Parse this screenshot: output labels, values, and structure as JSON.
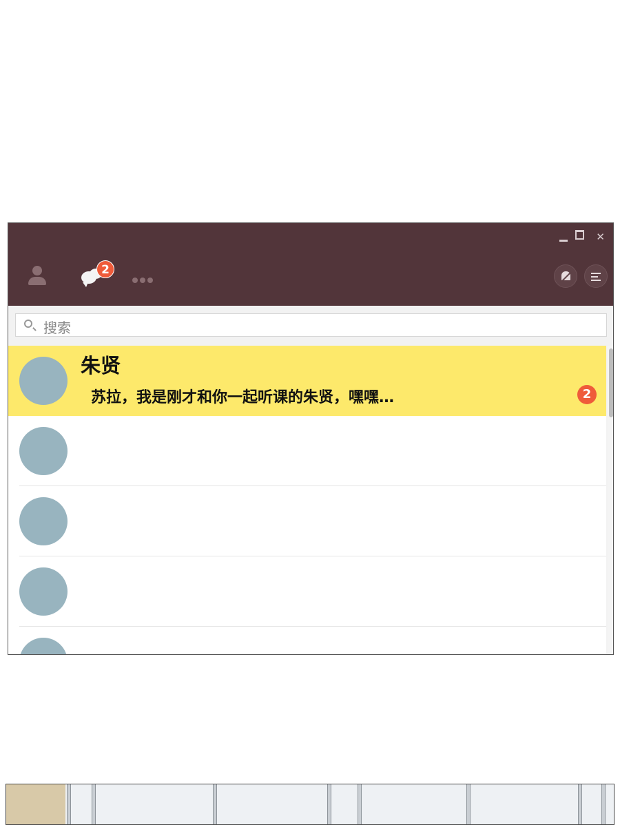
{
  "window": {
    "controls": {
      "minimize_icon": "minimize-icon",
      "maximize_icon": "maximize-icon",
      "close_icon": "close-icon"
    },
    "colors": {
      "titlebar": "#52353a",
      "highlight": "#fde96b",
      "badge": "#ef5b3a",
      "avatar": "#98b4bf"
    }
  },
  "nav": {
    "contacts_icon": "contact-person-icon",
    "chats_icon": "chat-bubbles-icon",
    "chats_badge": "2",
    "more_icon": "more-dots-icon",
    "mute_icon": "mute-bell-icon",
    "menu_icon": "menu-lines-icon"
  },
  "search": {
    "placeholder": "搜索"
  },
  "conversations": [
    {
      "name": "朱贤",
      "message": "苏拉，我是刚才和你一起听课的朱贤，嘿嘿…",
      "unread": "2",
      "active": true
    },
    {
      "name": "",
      "message": "",
      "unread": ""
    },
    {
      "name": "",
      "message": "",
      "unread": ""
    },
    {
      "name": "",
      "message": "",
      "unread": ""
    },
    {
      "name": "",
      "message": "",
      "unread": ""
    }
  ]
}
